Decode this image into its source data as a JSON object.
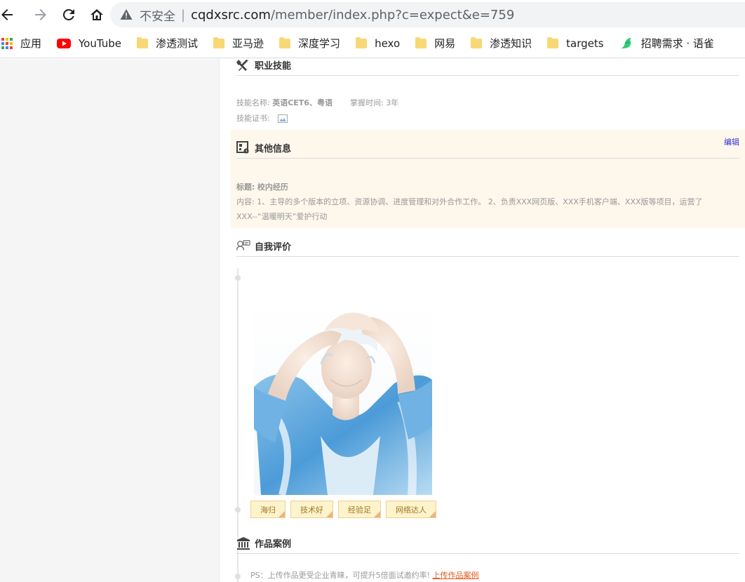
{
  "browser": {
    "security_label": "不安全",
    "separator": "|",
    "url_host": "cqdxsrc.com",
    "url_rest": "/member/index.php?c=expect&e=759"
  },
  "bookmarks": [
    {
      "label": "应用",
      "icon": "apps-grid-icon"
    },
    {
      "label": "YouTube",
      "icon": "youtube-icon"
    },
    {
      "label": "渗透测试",
      "icon": "folder-icon"
    },
    {
      "label": "亚马逊",
      "icon": "folder-icon"
    },
    {
      "label": "深度学习",
      "icon": "folder-icon"
    },
    {
      "label": "hexo",
      "icon": "folder-icon"
    },
    {
      "label": "网易",
      "icon": "folder-icon"
    },
    {
      "label": "渗透知识",
      "icon": "folder-icon"
    },
    {
      "label": "targets",
      "icon": "folder-icon"
    },
    {
      "label": "招聘需求 · 语雀",
      "icon": "yuque-bird-icon"
    }
  ],
  "skills": {
    "title": "职业技能",
    "name_label": "技能名称:",
    "name_value": "英语CET6、粤语",
    "time_label": "掌握时间:",
    "time_value": "3年",
    "cert_label": "技能证书:"
  },
  "other": {
    "title": "其他信息",
    "edit_label": "编辑",
    "heading_label": "标题:",
    "heading_value": "校内经历",
    "content_line1": "内容:  1、主导的多个版本的立项、资源协调、进度管理和对外合作工作。 2、负责XXX网页版、XXX手机客户端、XXX版等项目，运营了",
    "content_line2": "XXX--“温暖明天”爱护行动"
  },
  "self_eval": {
    "title": "自我评价",
    "tags": [
      "海归",
      "技术好",
      "经验足",
      "网络达人"
    ]
  },
  "works": {
    "title": "作品案例",
    "ps_text": "PS：上传作品更受企业青睐，可提升5倍面试邀约率!",
    "upload_link": "上传作品案例"
  },
  "colors": {
    "accent_link": "#3333cc",
    "upload_link": "#e05a1c",
    "other_bg": "#fdf7ec",
    "tag_bg": "#fdf3cc"
  }
}
